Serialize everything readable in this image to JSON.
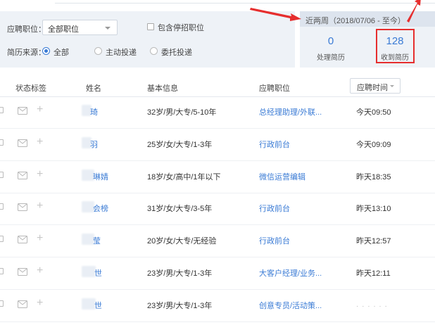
{
  "filters": {
    "position_label": "应聘职位：",
    "position_value": "全部职位",
    "include_closed_label": "包含停招职位",
    "source_label": "简历来源：",
    "source_options": [
      "全部",
      "主动投递",
      "委托投递"
    ]
  },
  "stats": {
    "period": "近两周（2018/07/06 - 至今）",
    "processed_value": "0",
    "processed_label": "处理简历",
    "received_value": "128",
    "received_label": "收到简历"
  },
  "table": {
    "headers": [
      "状态标签",
      "姓名",
      "基本信息",
      "应聘职位"
    ],
    "sort_label": "应聘时间",
    "rows": [
      {
        "name": "琦",
        "info": "32岁/男/大专/5-10年",
        "position": "总经理助理/外联...",
        "time": "今天09:50"
      },
      {
        "name": "羽",
        "info": "25岁/女/大专/1-3年",
        "position": "行政前台",
        "time": "今天09:09"
      },
      {
        "name": "琳婧",
        "info": "18岁/女/高中/1年以下",
        "position": "微信运营编辑",
        "time": "昨天18:35"
      },
      {
        "name": "会榜",
        "info": "31岁/女/大专/3-5年",
        "position": "行政前台",
        "time": "昨天13:10"
      },
      {
        "name": "莹",
        "info": "20岁/女/大专/无经验",
        "position": "行政前台",
        "time": "昨天12:57"
      },
      {
        "name": "世",
        "info": "23岁/男/大专/1-3年",
        "position": "大客户经理/业务...",
        "time": "昨天12:11"
      },
      {
        "name": "世",
        "info": "23岁/男/大专/1-3年",
        "position": "创意专员/活动策...",
        "time": ""
      }
    ]
  },
  "colors": {
    "accent": "#3a7bd5",
    "highlight": "#e62e2e"
  }
}
